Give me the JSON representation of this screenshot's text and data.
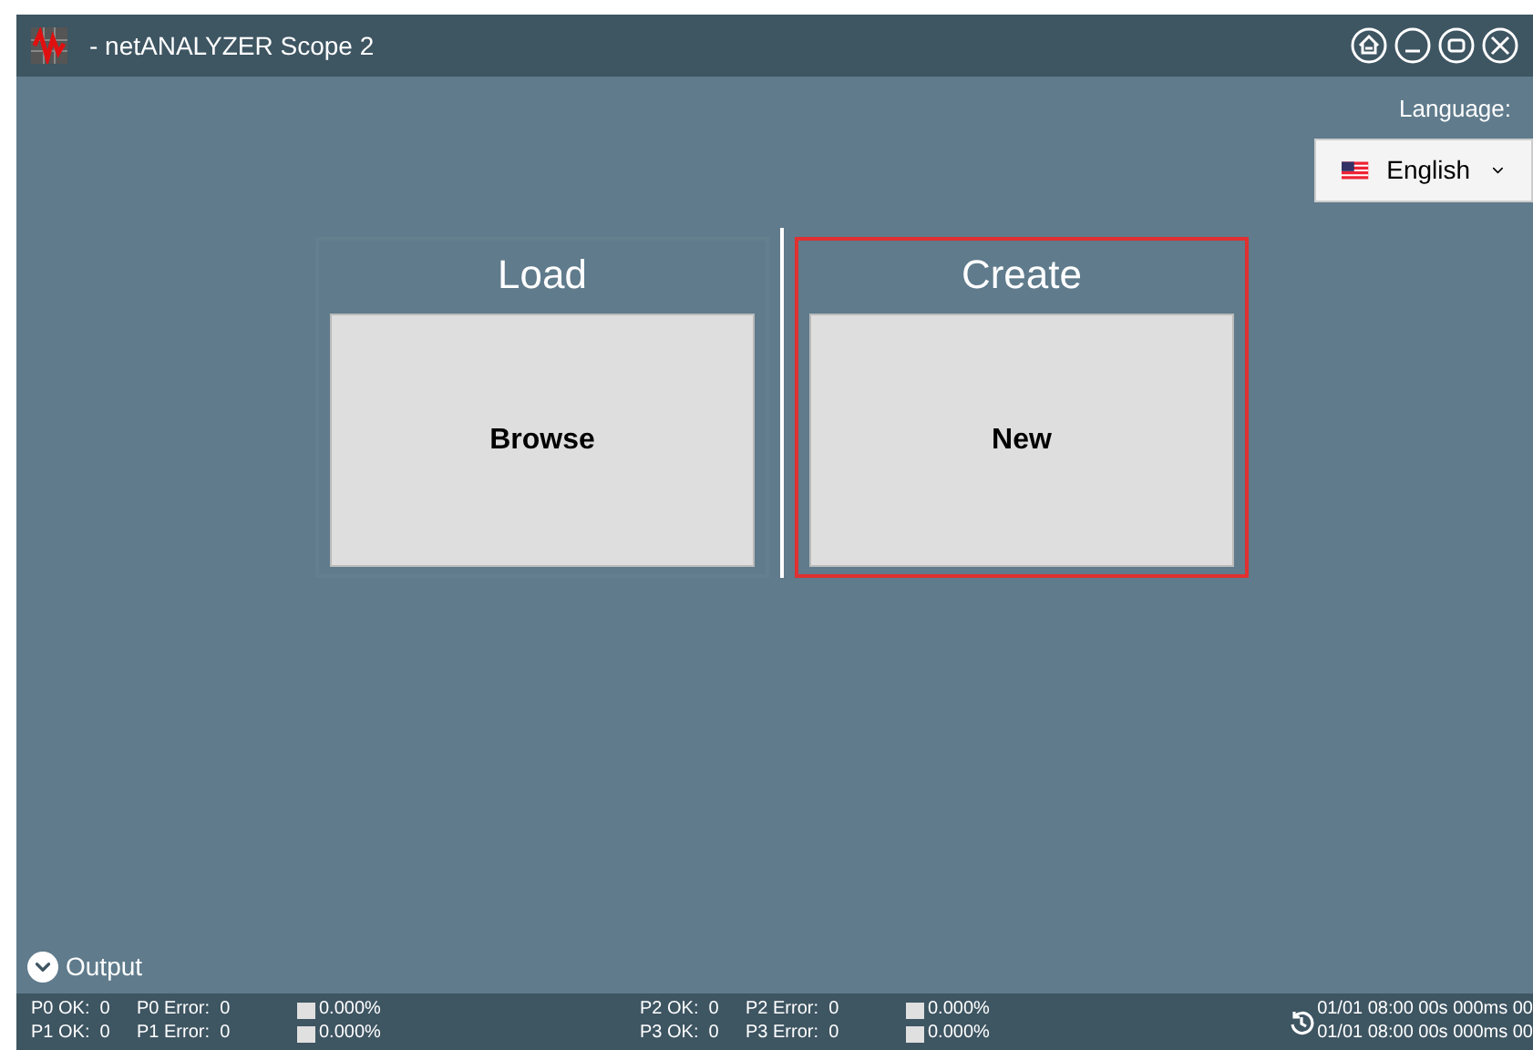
{
  "window": {
    "title": "- netANALYZER Scope 2"
  },
  "language": {
    "label": "Language:",
    "value": "English"
  },
  "panels": [
    {
      "heading": "Load",
      "button": "Browse",
      "highlighted": false
    },
    {
      "heading": "Create",
      "button": "New",
      "highlighted": true
    }
  ],
  "output": {
    "label": "Output",
    "expanded": false
  },
  "status_bar": {
    "ports": [
      {
        "ok": "P0 OK:  0",
        "error": "P0 Error:  0",
        "load": "0.000%"
      },
      {
        "ok": "P1 OK:  0",
        "error": "P1 Error:  0",
        "load": "0.000%"
      },
      {
        "ok": "P2 OK:  0",
        "error": "P2 Error:  0",
        "load": "0.000%"
      },
      {
        "ok": "P3 OK:  0",
        "error": "P3 Error:  0",
        "load": "0.000%"
      }
    ],
    "timestamps": [
      "01/01 08:00 00s 000ms 00",
      "01/01 08:00 00s 000ms 00"
    ]
  }
}
